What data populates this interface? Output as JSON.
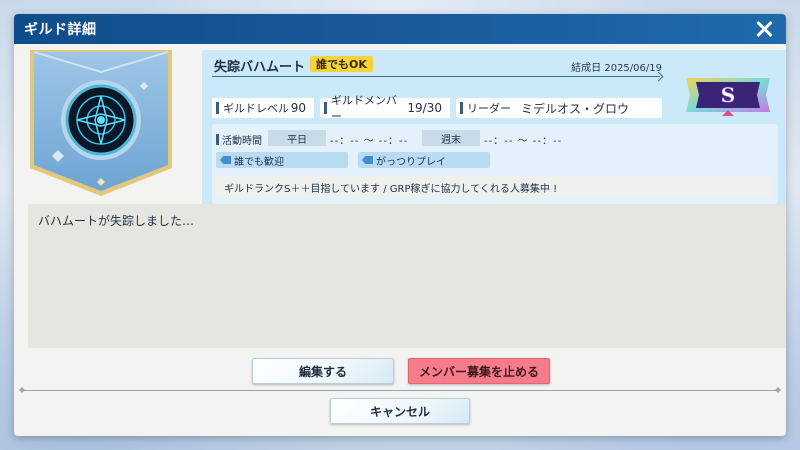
{
  "dialog": {
    "title": "ギルド詳細"
  },
  "guild": {
    "name": "失踪バハムート",
    "open_badge": "誰でもOK",
    "founded": "結成日 2025/06/19",
    "rank_badge": "S",
    "stats": {
      "level_label": "ギルドレベル",
      "level_value": "90",
      "members_label": "ギルドメンバー",
      "members_value": "19/30",
      "leader_label": "リーダー",
      "leader_value": "ミデルオス・グロウ"
    },
    "activity": {
      "label": "活動時間",
      "weekday_label": "平日",
      "weekday_time": "--：-- 〜 --：--",
      "weekend_label": "週末",
      "weekend_time": "--：-- 〜 --：--"
    },
    "tags": [
      "誰でも歓迎",
      "がっつりプレイ"
    ],
    "comment": "ギルドランクS＋＋目指しています / GRP稼ぎに協力してくれる人募集中 !"
  },
  "message": "バハムートが失踪しました…",
  "buttons": {
    "edit": "編集する",
    "stop_recruit": "メンバー募集を止める",
    "cancel": "キャンセル"
  },
  "colors": {
    "titlebar": "#0f4c8a",
    "info_panel": "#cce9fa",
    "badge_yellow": "#f7d23a",
    "stop_button": "#f67c8a"
  }
}
